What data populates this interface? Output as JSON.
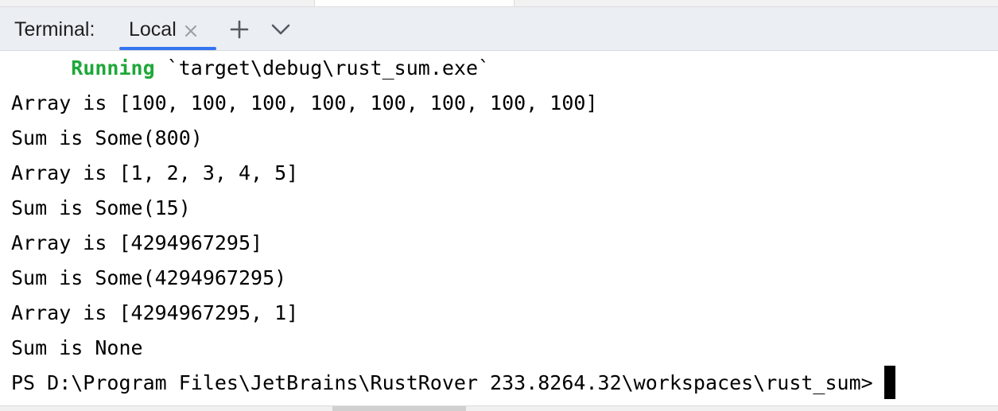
{
  "header": {
    "title": "Terminal:",
    "tab_label": "Local",
    "close_icon": "close-icon",
    "add_icon": "plus-icon",
    "dropdown_icon": "chevron-down-icon",
    "accent_color": "#3574f0"
  },
  "terminal": {
    "running_keyword": "Running",
    "running_path": "`target\\debug\\rust_sum.exe`",
    "running_color": "#1ea839",
    "lines": [
      "Array is [100, 100, 100, 100, 100, 100, 100, 100]",
      "Sum is Some(800)",
      "Array is [1, 2, 3, 4, 5]",
      "Sum is Some(15)",
      "Array is [4294967295]",
      "Sum is Some(4294967295)",
      "Array is [4294967295, 1]",
      "Sum is None"
    ],
    "prompt": "PS D:\\Program Files\\JetBrains\\RustRover 233.8264.32\\workspaces\\rust_sum>"
  }
}
